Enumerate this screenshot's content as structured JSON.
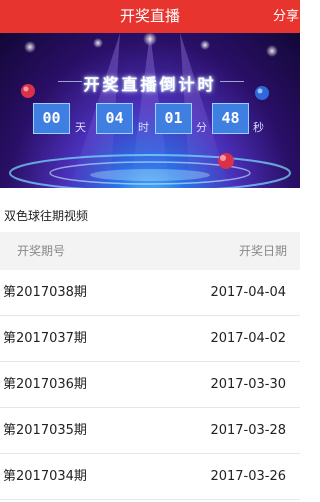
{
  "header": {
    "title": "开奖直播",
    "share_label": "分享"
  },
  "banner": {
    "headline": "开奖直播倒计时",
    "countdown": [
      {
        "value": "00",
        "unit": "天"
      },
      {
        "value": "04",
        "unit": "时"
      },
      {
        "value": "01",
        "unit": "分"
      },
      {
        "value": "48",
        "unit": "秒"
      }
    ]
  },
  "section": {
    "title": "双色球往期视频"
  },
  "table": {
    "headers": {
      "period": "开奖期号",
      "date": "开奖日期"
    },
    "rows": [
      {
        "period": "第2017038期",
        "date": "2017-04-04"
      },
      {
        "period": "第2017037期",
        "date": "2017-04-02"
      },
      {
        "period": "第2017036期",
        "date": "2017-03-30"
      },
      {
        "period": "第2017035期",
        "date": "2017-03-28"
      },
      {
        "period": "第2017034期",
        "date": "2017-03-26"
      }
    ]
  },
  "colors": {
    "accent": "#e8342f",
    "countdown_box": "#3e7fe1"
  }
}
